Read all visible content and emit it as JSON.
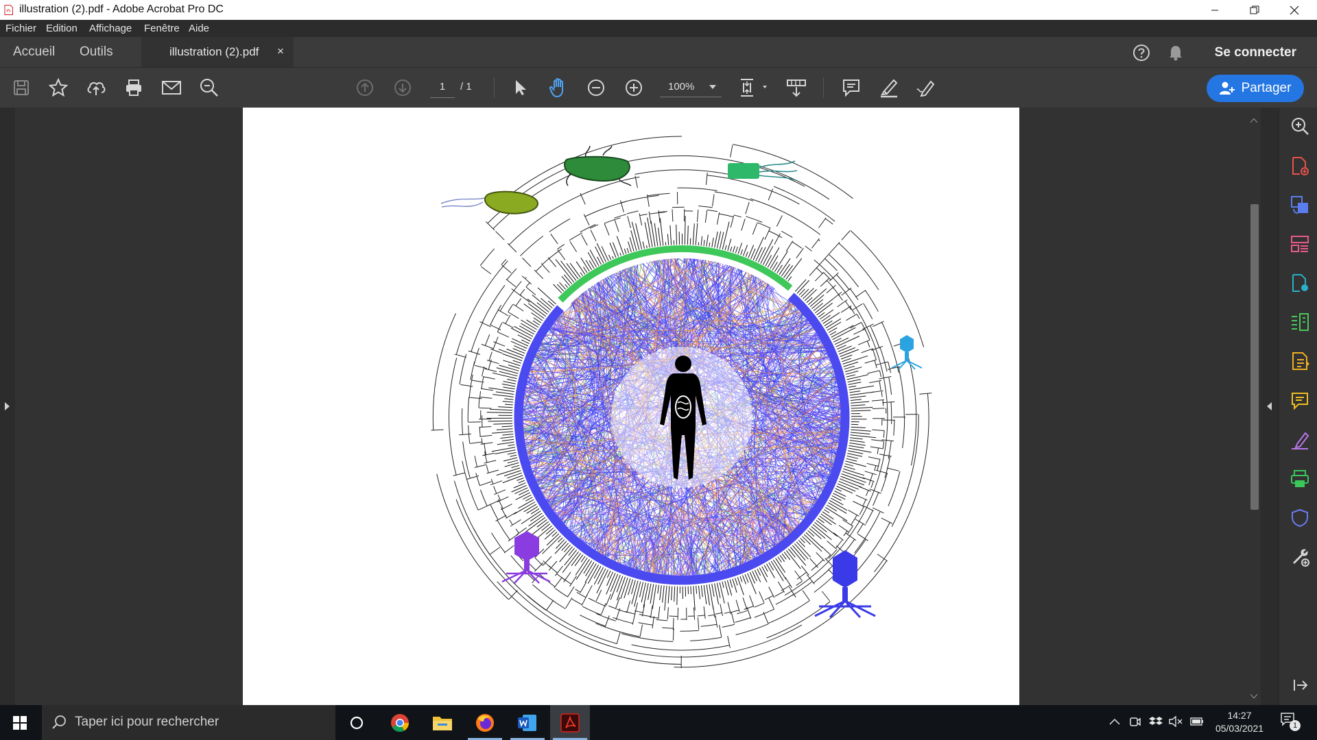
{
  "window": {
    "title": "illustration (2).pdf - Adobe Acrobat Pro DC"
  },
  "menu": {
    "items": [
      "Fichier",
      "Edition",
      "Affichage",
      "Fenêtre",
      "Aide"
    ]
  },
  "tabs": {
    "home": "Accueil",
    "tools": "Outils",
    "document": "illustration (2).pdf",
    "close_glyph": "×"
  },
  "header": {
    "help_icon": "help-circle-icon",
    "bell_icon": "bell-icon",
    "signin_label": "Se connecter"
  },
  "toolbar": {
    "current_page": "1",
    "total_pages": "/ 1",
    "zoom": "100%",
    "share_label": "Partager"
  },
  "taskbar": {
    "search_placeholder": "Taper ici pour rechercher",
    "time": "14:27",
    "date": "05/03/2021",
    "notification_count": "1"
  },
  "colors": {
    "accent": "#2476e2",
    "ring_main": "#4a4af0",
    "ring_green": "#3fc85a",
    "phage_purple": "#8a3ce0",
    "phage_blue": "#3a3ae8",
    "phage_cyan": "#2aa3e0",
    "bacteria_green": "#2e8b3a",
    "bacteria_olive": "#8aaa22"
  }
}
